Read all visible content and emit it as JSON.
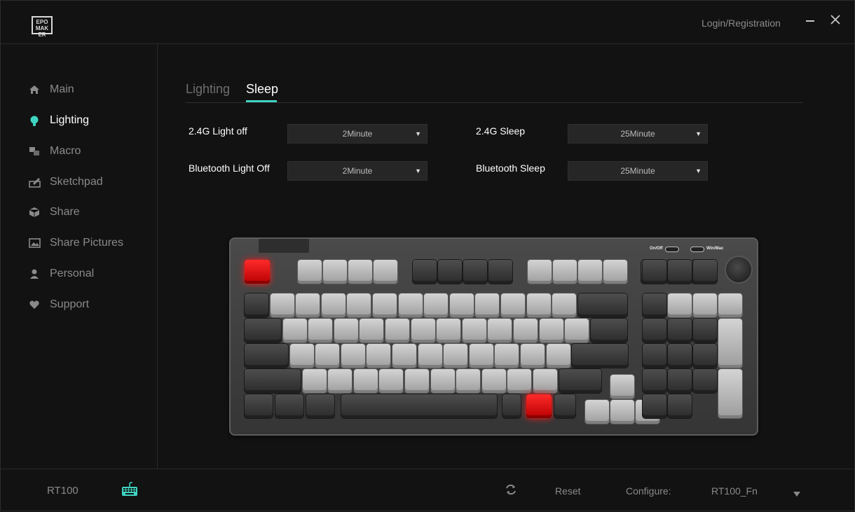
{
  "titlebar": {
    "logo_text": "EPOMAKER",
    "login_label": "Login/Registration",
    "minimize_icon": "minimize-icon",
    "close_icon": "close-icon"
  },
  "sidebar": {
    "items": [
      {
        "label": "Main",
        "icon": "home-icon"
      },
      {
        "label": "Lighting",
        "icon": "bulb-icon",
        "active": true
      },
      {
        "label": "Macro",
        "icon": "macro-icon"
      },
      {
        "label": "Sketchpad",
        "icon": "sketchpad-icon"
      },
      {
        "label": "Share",
        "icon": "cube-icon"
      },
      {
        "label": "Share Pictures",
        "icon": "picture-icon"
      },
      {
        "label": "Personal",
        "icon": "person-icon"
      },
      {
        "label": "Support",
        "icon": "heart-icon"
      }
    ]
  },
  "tabs": [
    {
      "label": "Lighting"
    },
    {
      "label": "Sleep",
      "active": true
    }
  ],
  "sleep": {
    "light_off_24g_label": "2.4G Light off",
    "light_off_24g_value": "2Minute",
    "sleep_24g_label": "2.4G Sleep",
    "sleep_24g_value": "25Minute",
    "bt_light_off_label": "Bluetooth Light Off",
    "bt_light_off_value": "2Minute",
    "bt_sleep_label": "Bluetooth Sleep",
    "bt_sleep_value": "25Minute"
  },
  "keyboard": {
    "onoff_label": "On/Off",
    "winmac_label": "Win/Mac"
  },
  "footer": {
    "model": "RT100",
    "reset_label": "Reset",
    "configure_label": "Configure:",
    "configure_value": "RT100_Fn"
  },
  "colors": {
    "accent": "#3fd3c2",
    "highlight_key": "#ff1a1a",
    "background": "#121212"
  }
}
